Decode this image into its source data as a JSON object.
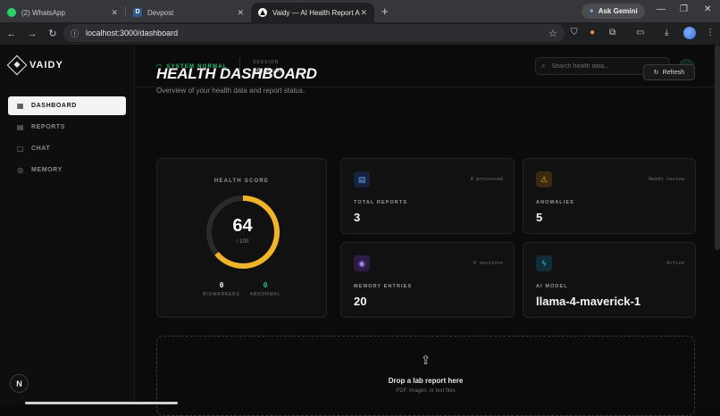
{
  "browser": {
    "tabs": [
      {
        "label": "(2) WhatsApp"
      },
      {
        "label": "Devpost"
      },
      {
        "label": "Vaidy — AI Health Report Analy"
      }
    ],
    "gemini_label": "Ask Gemini",
    "url": "localhost:3000/dashboard"
  },
  "app": {
    "brand": "VAIDY",
    "nav": [
      {
        "label": "DASHBOARD",
        "active": true
      },
      {
        "label": "REPORTS"
      },
      {
        "label": "CHAT"
      },
      {
        "label": "MEMORY"
      }
    ],
    "bottom_badge": "N"
  },
  "topbar": {
    "system_status": "SYSTEM NORMAL",
    "session_label": "SESSION",
    "session_value": "00:00:09",
    "search_placeholder": "Search health data..."
  },
  "page": {
    "title": "HEALTH DASHBOARD",
    "subtitle": "Overview of your health data and report status.",
    "refresh_label": "Refresh"
  },
  "health_score": {
    "label": "HEALTH SCORE",
    "value": 64,
    "max_text": "/ 100",
    "fraction": 0.64,
    "biomarkers_value": "0",
    "biomarkers_label": "BIOMARKERS",
    "abnormal_value": "0",
    "abnormal_label": "ABNORMAL"
  },
  "cards": {
    "total_reports": {
      "corner": "0 processed",
      "label": "TOTAL REPORTS",
      "value": "3"
    },
    "anomalies": {
      "corner": "Needs review",
      "label": "ANOMALIES",
      "value": "5"
    },
    "memory": {
      "corner": "0 sessions",
      "label": "MEMORY ENTRIES",
      "value": "20"
    },
    "ai_model": {
      "corner": "Active",
      "label": "AI MODEL",
      "value": "llama-4-maverick-1"
    }
  },
  "dropzone": {
    "title": "Drop a lab report here",
    "subtitle": "PDF, images, or text files"
  },
  "colors": {
    "accent_green": "#1ec27a",
    "gauge_amber": "#f0b429",
    "gauge_track": "#2a2a2a"
  },
  "icons": {
    "total_reports": "document-icon",
    "anomalies": "warning-icon",
    "memory": "memory-icon",
    "ai_model": "bolt-icon"
  }
}
